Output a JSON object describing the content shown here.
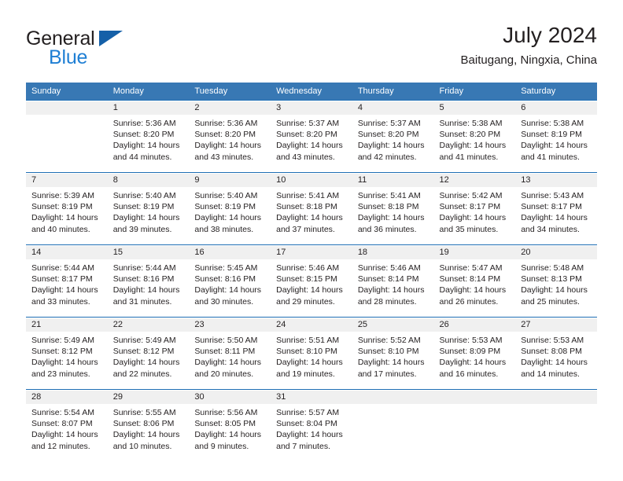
{
  "brand": {
    "line1": "General",
    "line2": "Blue",
    "triangle_color": "#1560a8",
    "blue_text_color": "#1f7fd4"
  },
  "header": {
    "title": "July 2024",
    "subtitle": "Baitugang, Ningxia, China"
  },
  "theme": {
    "header_blue": "#3878b4",
    "rule_blue": "#1f6eb4",
    "daynum_band": "#f0f0f0",
    "text": "#231f20"
  },
  "weekday_headers": [
    "Sunday",
    "Monday",
    "Tuesday",
    "Wednesday",
    "Thursday",
    "Friday",
    "Saturday"
  ],
  "weeks": [
    [
      {
        "day": "",
        "sunrise": "",
        "sunset": "",
        "daylight_line1": "",
        "daylight_line2": ""
      },
      {
        "day": "1",
        "sunrise": "Sunrise: 5:36 AM",
        "sunset": "Sunset: 8:20 PM",
        "daylight_line1": "Daylight: 14 hours",
        "daylight_line2": "and 44 minutes."
      },
      {
        "day": "2",
        "sunrise": "Sunrise: 5:36 AM",
        "sunset": "Sunset: 8:20 PM",
        "daylight_line1": "Daylight: 14 hours",
        "daylight_line2": "and 43 minutes."
      },
      {
        "day": "3",
        "sunrise": "Sunrise: 5:37 AM",
        "sunset": "Sunset: 8:20 PM",
        "daylight_line1": "Daylight: 14 hours",
        "daylight_line2": "and 43 minutes."
      },
      {
        "day": "4",
        "sunrise": "Sunrise: 5:37 AM",
        "sunset": "Sunset: 8:20 PM",
        "daylight_line1": "Daylight: 14 hours",
        "daylight_line2": "and 42 minutes."
      },
      {
        "day": "5",
        "sunrise": "Sunrise: 5:38 AM",
        "sunset": "Sunset: 8:20 PM",
        "daylight_line1": "Daylight: 14 hours",
        "daylight_line2": "and 41 minutes."
      },
      {
        "day": "6",
        "sunrise": "Sunrise: 5:38 AM",
        "sunset": "Sunset: 8:19 PM",
        "daylight_line1": "Daylight: 14 hours",
        "daylight_line2": "and 41 minutes."
      }
    ],
    [
      {
        "day": "7",
        "sunrise": "Sunrise: 5:39 AM",
        "sunset": "Sunset: 8:19 PM",
        "daylight_line1": "Daylight: 14 hours",
        "daylight_line2": "and 40 minutes."
      },
      {
        "day": "8",
        "sunrise": "Sunrise: 5:40 AM",
        "sunset": "Sunset: 8:19 PM",
        "daylight_line1": "Daylight: 14 hours",
        "daylight_line2": "and 39 minutes."
      },
      {
        "day": "9",
        "sunrise": "Sunrise: 5:40 AM",
        "sunset": "Sunset: 8:19 PM",
        "daylight_line1": "Daylight: 14 hours",
        "daylight_line2": "and 38 minutes."
      },
      {
        "day": "10",
        "sunrise": "Sunrise: 5:41 AM",
        "sunset": "Sunset: 8:18 PM",
        "daylight_line1": "Daylight: 14 hours",
        "daylight_line2": "and 37 minutes."
      },
      {
        "day": "11",
        "sunrise": "Sunrise: 5:41 AM",
        "sunset": "Sunset: 8:18 PM",
        "daylight_line1": "Daylight: 14 hours",
        "daylight_line2": "and 36 minutes."
      },
      {
        "day": "12",
        "sunrise": "Sunrise: 5:42 AM",
        "sunset": "Sunset: 8:17 PM",
        "daylight_line1": "Daylight: 14 hours",
        "daylight_line2": "and 35 minutes."
      },
      {
        "day": "13",
        "sunrise": "Sunrise: 5:43 AM",
        "sunset": "Sunset: 8:17 PM",
        "daylight_line1": "Daylight: 14 hours",
        "daylight_line2": "and 34 minutes."
      }
    ],
    [
      {
        "day": "14",
        "sunrise": "Sunrise: 5:44 AM",
        "sunset": "Sunset: 8:17 PM",
        "daylight_line1": "Daylight: 14 hours",
        "daylight_line2": "and 33 minutes."
      },
      {
        "day": "15",
        "sunrise": "Sunrise: 5:44 AM",
        "sunset": "Sunset: 8:16 PM",
        "daylight_line1": "Daylight: 14 hours",
        "daylight_line2": "and 31 minutes."
      },
      {
        "day": "16",
        "sunrise": "Sunrise: 5:45 AM",
        "sunset": "Sunset: 8:16 PM",
        "daylight_line1": "Daylight: 14 hours",
        "daylight_line2": "and 30 minutes."
      },
      {
        "day": "17",
        "sunrise": "Sunrise: 5:46 AM",
        "sunset": "Sunset: 8:15 PM",
        "daylight_line1": "Daylight: 14 hours",
        "daylight_line2": "and 29 minutes."
      },
      {
        "day": "18",
        "sunrise": "Sunrise: 5:46 AM",
        "sunset": "Sunset: 8:14 PM",
        "daylight_line1": "Daylight: 14 hours",
        "daylight_line2": "and 28 minutes."
      },
      {
        "day": "19",
        "sunrise": "Sunrise: 5:47 AM",
        "sunset": "Sunset: 8:14 PM",
        "daylight_line1": "Daylight: 14 hours",
        "daylight_line2": "and 26 minutes."
      },
      {
        "day": "20",
        "sunrise": "Sunrise: 5:48 AM",
        "sunset": "Sunset: 8:13 PM",
        "daylight_line1": "Daylight: 14 hours",
        "daylight_line2": "and 25 minutes."
      }
    ],
    [
      {
        "day": "21",
        "sunrise": "Sunrise: 5:49 AM",
        "sunset": "Sunset: 8:12 PM",
        "daylight_line1": "Daylight: 14 hours",
        "daylight_line2": "and 23 minutes."
      },
      {
        "day": "22",
        "sunrise": "Sunrise: 5:49 AM",
        "sunset": "Sunset: 8:12 PM",
        "daylight_line1": "Daylight: 14 hours",
        "daylight_line2": "and 22 minutes."
      },
      {
        "day": "23",
        "sunrise": "Sunrise: 5:50 AM",
        "sunset": "Sunset: 8:11 PM",
        "daylight_line1": "Daylight: 14 hours",
        "daylight_line2": "and 20 minutes."
      },
      {
        "day": "24",
        "sunrise": "Sunrise: 5:51 AM",
        "sunset": "Sunset: 8:10 PM",
        "daylight_line1": "Daylight: 14 hours",
        "daylight_line2": "and 19 minutes."
      },
      {
        "day": "25",
        "sunrise": "Sunrise: 5:52 AM",
        "sunset": "Sunset: 8:10 PM",
        "daylight_line1": "Daylight: 14 hours",
        "daylight_line2": "and 17 minutes."
      },
      {
        "day": "26",
        "sunrise": "Sunrise: 5:53 AM",
        "sunset": "Sunset: 8:09 PM",
        "daylight_line1": "Daylight: 14 hours",
        "daylight_line2": "and 16 minutes."
      },
      {
        "day": "27",
        "sunrise": "Sunrise: 5:53 AM",
        "sunset": "Sunset: 8:08 PM",
        "daylight_line1": "Daylight: 14 hours",
        "daylight_line2": "and 14 minutes."
      }
    ],
    [
      {
        "day": "28",
        "sunrise": "Sunrise: 5:54 AM",
        "sunset": "Sunset: 8:07 PM",
        "daylight_line1": "Daylight: 14 hours",
        "daylight_line2": "and 12 minutes."
      },
      {
        "day": "29",
        "sunrise": "Sunrise: 5:55 AM",
        "sunset": "Sunset: 8:06 PM",
        "daylight_line1": "Daylight: 14 hours",
        "daylight_line2": "and 10 minutes."
      },
      {
        "day": "30",
        "sunrise": "Sunrise: 5:56 AM",
        "sunset": "Sunset: 8:05 PM",
        "daylight_line1": "Daylight: 14 hours",
        "daylight_line2": "and 9 minutes."
      },
      {
        "day": "31",
        "sunrise": "Sunrise: 5:57 AM",
        "sunset": "Sunset: 8:04 PM",
        "daylight_line1": "Daylight: 14 hours",
        "daylight_line2": "and 7 minutes."
      },
      {
        "day": "",
        "sunrise": "",
        "sunset": "",
        "daylight_line1": "",
        "daylight_line2": ""
      },
      {
        "day": "",
        "sunrise": "",
        "sunset": "",
        "daylight_line1": "",
        "daylight_line2": ""
      },
      {
        "day": "",
        "sunrise": "",
        "sunset": "",
        "daylight_line1": "",
        "daylight_line2": ""
      }
    ]
  ]
}
